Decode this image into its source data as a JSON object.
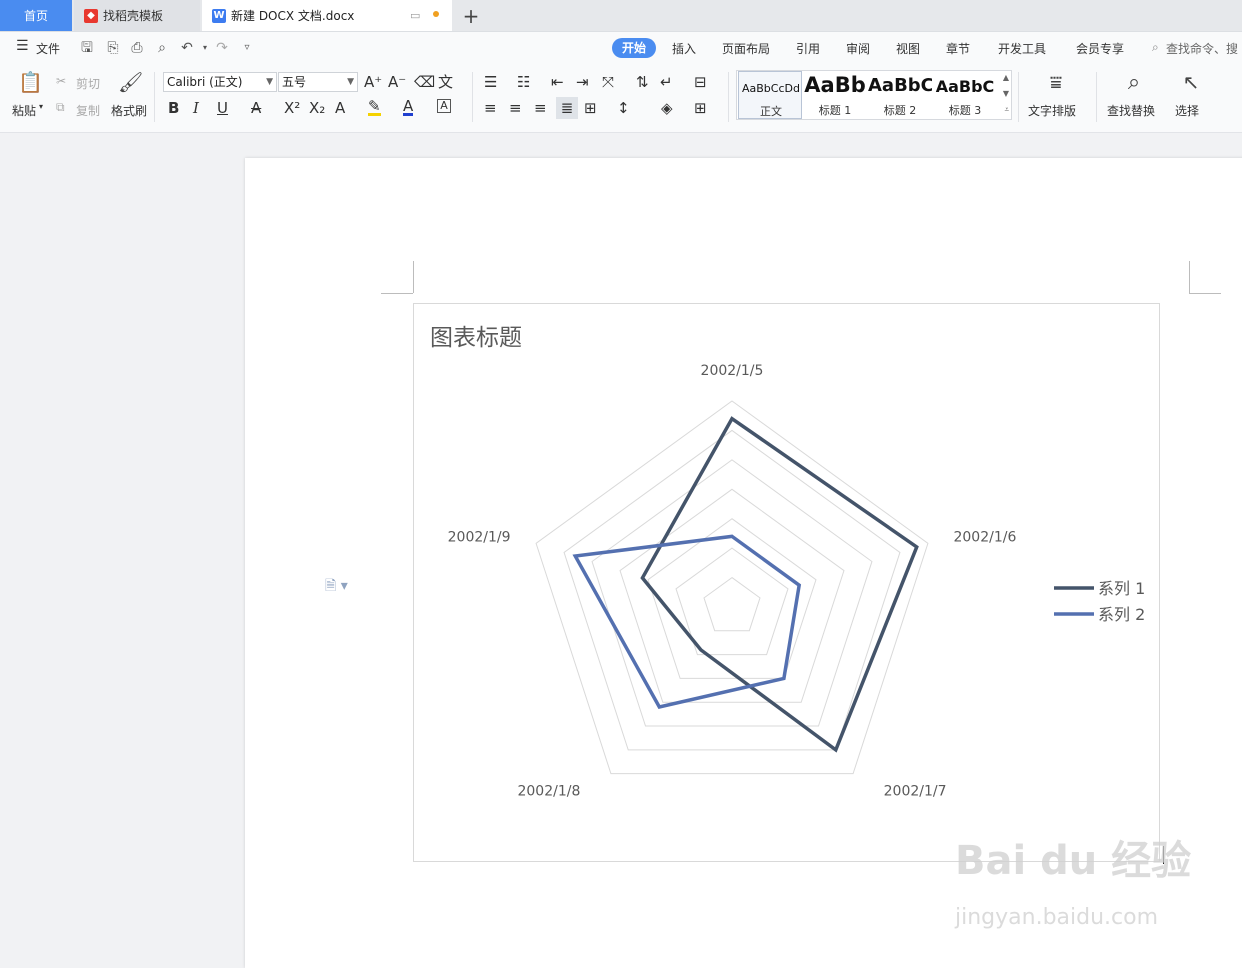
{
  "tabs": {
    "home": "首页",
    "template": "找稻壳模板",
    "document": "新建 DOCX 文档.docx",
    "add": "+"
  },
  "menu": {
    "file": "文件",
    "items": [
      "开始",
      "插入",
      "页面布局",
      "引用",
      "审阅",
      "视图",
      "章节",
      "开发工具",
      "会员专享"
    ],
    "search": "查找命令、搜"
  },
  "ribbon": {
    "paste": "粘贴",
    "cut": "剪切",
    "copy": "复制",
    "format_painter": "格式刷",
    "font_name": "Calibri (正文)",
    "font_size": "五号",
    "text_layout": "文字排版",
    "find_replace": "查找替换",
    "select": "选择",
    "styles": [
      {
        "sample": "AaBbCcDd",
        "label": "正文"
      },
      {
        "sample": "AaBb",
        "label": "标题 1"
      },
      {
        "sample": "AaBbC",
        "label": "标题 2"
      },
      {
        "sample": "AaBbC",
        "label": "标题 3"
      }
    ]
  },
  "colors": {
    "accent": "#4a8cf0",
    "series1": "#44546a",
    "series2": "#5470b0",
    "grid": "#d9d9d9"
  },
  "chart_data": {
    "type": "radar",
    "title": "图表标题",
    "categories": [
      "2002/1/5",
      "2002/1/6",
      "2002/1/7",
      "2002/1/8",
      "2002/1/9"
    ],
    "rmax": 35,
    "rings": 7,
    "series": [
      {
        "name": "系列 1",
        "values": [
          32,
          33,
          30,
          9,
          16
        ]
      },
      {
        "name": "系列 2",
        "values": [
          12,
          12,
          15,
          21,
          28
        ]
      }
    ],
    "legend": "right"
  },
  "watermark": {
    "line1": "Bai du 经验",
    "line2": "jingyan.baidu.com"
  }
}
